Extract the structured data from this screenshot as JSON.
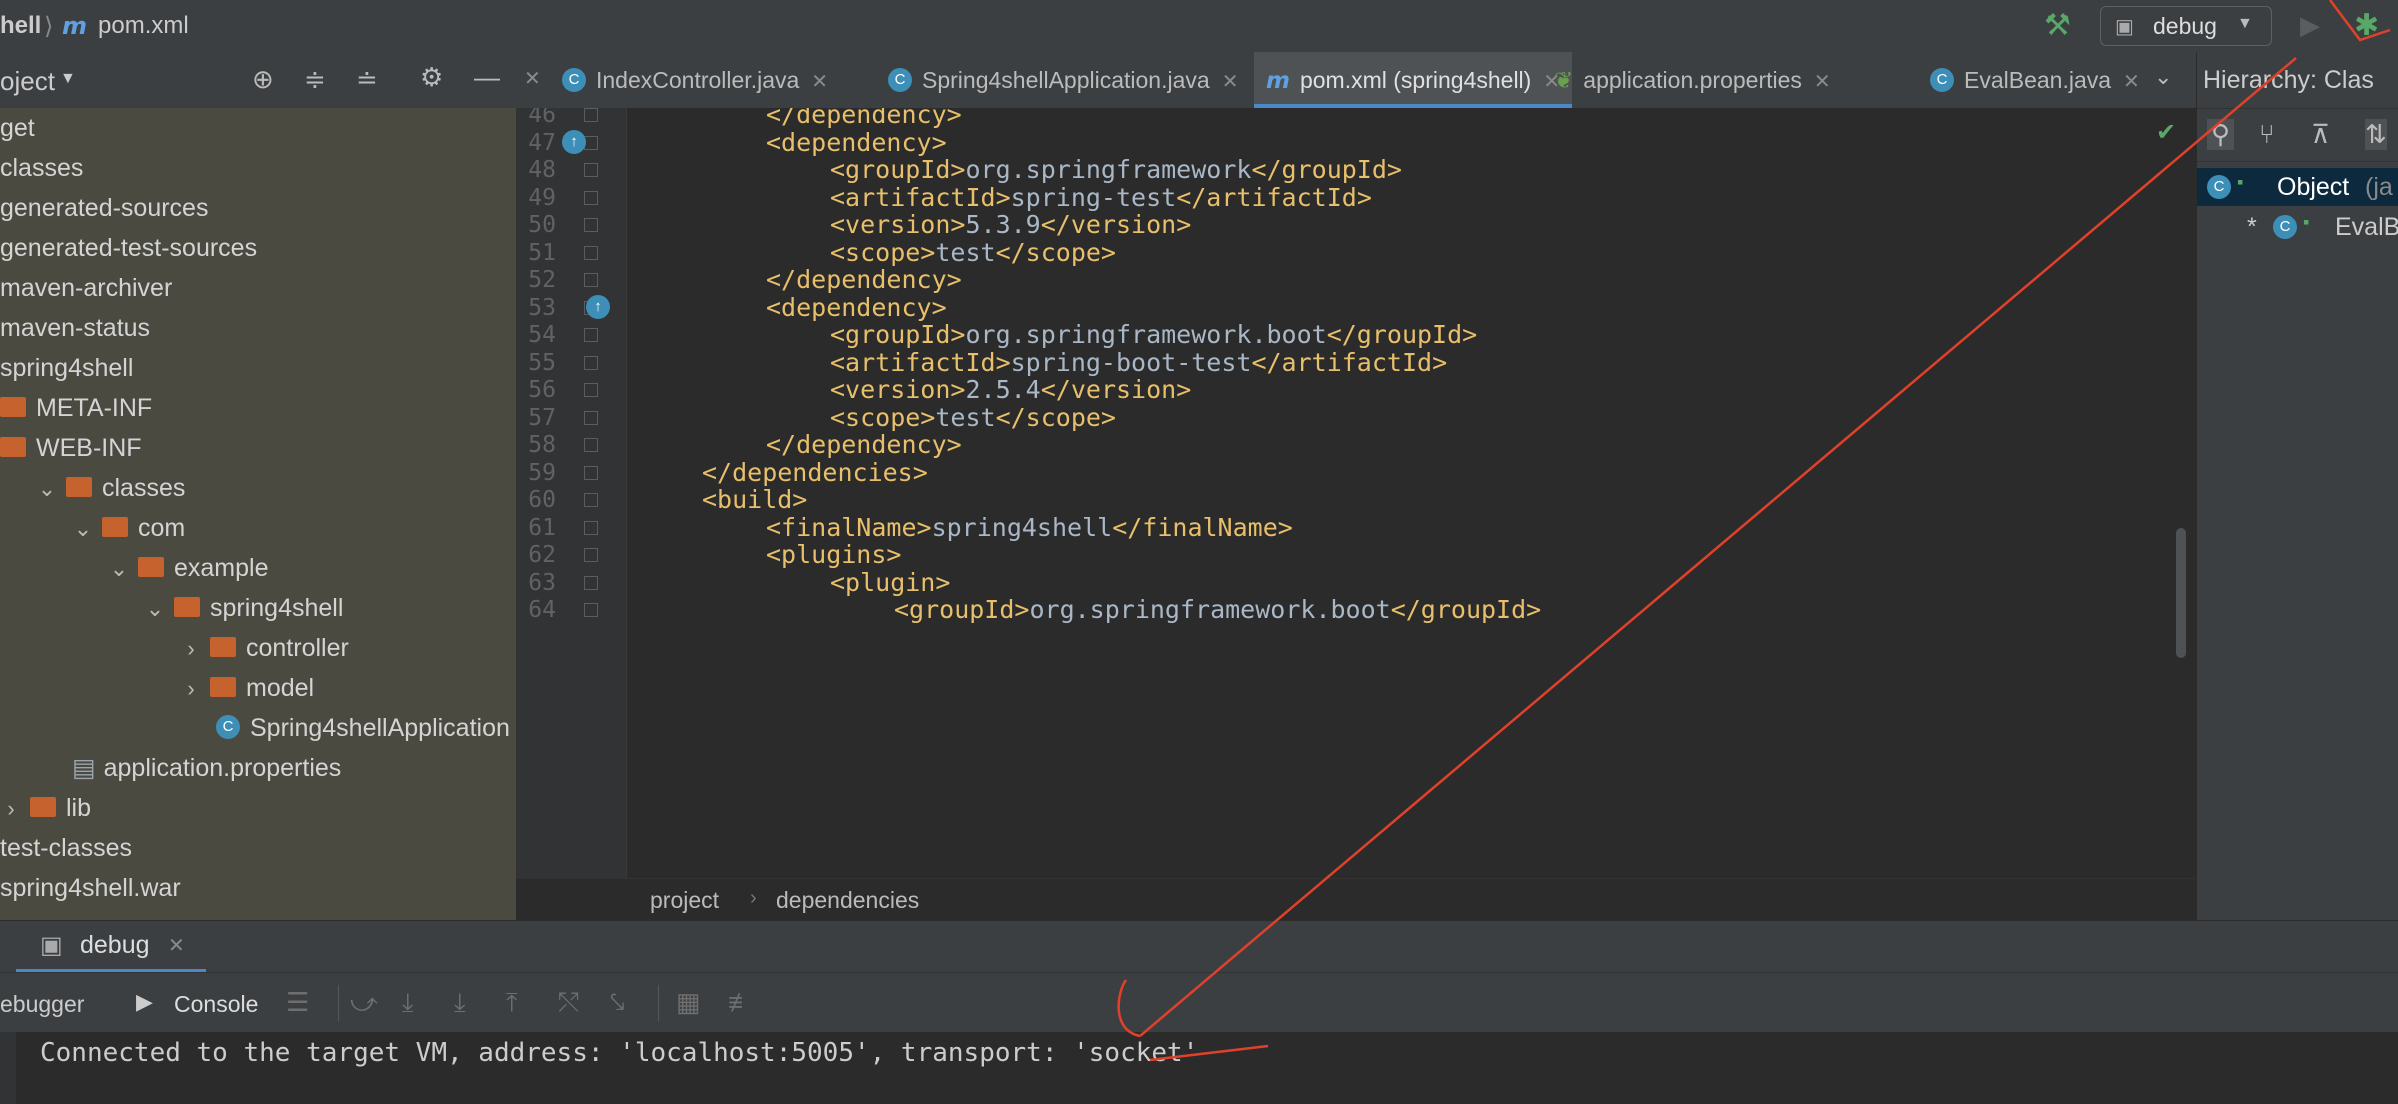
{
  "titlebar": {
    "project_crumb": "hell",
    "file_crumb": "pom.xml",
    "run_config": "debug",
    "colors": {
      "build": "#59a869",
      "debug": "#59a869"
    }
  },
  "project_panel": {
    "title": "oject",
    "tree": [
      {
        "label": "get",
        "type": "text",
        "indent": 0
      },
      {
        "label": "classes",
        "type": "text",
        "indent": 0
      },
      {
        "label": "generated-sources",
        "type": "text",
        "indent": 0
      },
      {
        "label": "generated-test-sources",
        "type": "text",
        "indent": 0
      },
      {
        "label": "maven-archiver",
        "type": "text",
        "indent": 0
      },
      {
        "label": "maven-status",
        "type": "text",
        "indent": 0
      },
      {
        "label": "spring4shell",
        "type": "text",
        "indent": 0
      },
      {
        "label": "META-INF",
        "type": "folder",
        "indent": 0
      },
      {
        "label": "WEB-INF",
        "type": "folder",
        "indent": 0
      },
      {
        "label": "classes",
        "type": "folder-open",
        "indent": 1
      },
      {
        "label": "com",
        "type": "folder-open",
        "indent": 2
      },
      {
        "label": "example",
        "type": "folder-open",
        "indent": 3
      },
      {
        "label": "spring4shell",
        "type": "folder-open",
        "indent": 4
      },
      {
        "label": "controller",
        "type": "folder-closed",
        "indent": 5
      },
      {
        "label": "model",
        "type": "folder-closed",
        "indent": 5
      },
      {
        "label": "Spring4shellApplication",
        "type": "class",
        "indent": 6
      },
      {
        "label": "application.properties",
        "type": "props",
        "indent": 2
      },
      {
        "label": "lib",
        "type": "folder-closed",
        "indent": 0
      },
      {
        "label": "test-classes",
        "type": "text",
        "indent": 0
      },
      {
        "label": "spring4shell.war",
        "type": "text",
        "indent": 0
      }
    ]
  },
  "tabs": [
    {
      "label": "IndexController.java",
      "icon": "class-icon",
      "active": false
    },
    {
      "label": "Spring4shellApplication.java",
      "icon": "spring-class-icon",
      "active": false
    },
    {
      "label": "pom.xml (spring4shell)",
      "icon": "maven-icon",
      "active": true
    },
    {
      "label": "application.properties",
      "icon": "spring-props-icon",
      "active": false
    },
    {
      "label": "EvalBean.java",
      "icon": "class-icon",
      "active": false
    }
  ],
  "editor": {
    "lines": [
      {
        "n": "46",
        "indent": 2,
        "parts": [
          [
            "t",
            "</dependency>"
          ]
        ]
      },
      {
        "n": "47",
        "indent": 2,
        "parts": [
          [
            "t",
            "<dependency>"
          ]
        ]
      },
      {
        "n": "48",
        "indent": 3,
        "parts": [
          [
            "t",
            "<groupId>"
          ],
          [
            "v",
            "org.springframework"
          ],
          [
            "t",
            "</groupId>"
          ]
        ]
      },
      {
        "n": "49",
        "indent": 3,
        "parts": [
          [
            "t",
            "<artifactId>"
          ],
          [
            "v",
            "spring-test"
          ],
          [
            "t",
            "</artifactId>"
          ]
        ]
      },
      {
        "n": "50",
        "indent": 3,
        "parts": [
          [
            "t",
            "<version>"
          ],
          [
            "v",
            "5.3.9"
          ],
          [
            "t",
            "</version>"
          ]
        ]
      },
      {
        "n": "51",
        "indent": 3,
        "parts": [
          [
            "t",
            "<scope>"
          ],
          [
            "v",
            "test"
          ],
          [
            "t",
            "</scope>"
          ]
        ]
      },
      {
        "n": "52",
        "indent": 2,
        "parts": [
          [
            "t",
            "</dependency>"
          ]
        ]
      },
      {
        "n": "53",
        "indent": 2,
        "parts": [
          [
            "t",
            "<dependency>"
          ]
        ]
      },
      {
        "n": "54",
        "indent": 3,
        "parts": [
          [
            "t",
            "<groupId>"
          ],
          [
            "v",
            "org.springframework.boot"
          ],
          [
            "t",
            "</groupId>"
          ]
        ]
      },
      {
        "n": "55",
        "indent": 3,
        "parts": [
          [
            "t",
            "<artifactId>"
          ],
          [
            "v",
            "spring-boot-test"
          ],
          [
            "t",
            "</artifactId>"
          ]
        ]
      },
      {
        "n": "56",
        "indent": 3,
        "parts": [
          [
            "t",
            "<version>"
          ],
          [
            "v",
            "2.5.4"
          ],
          [
            "t",
            "</version>"
          ]
        ]
      },
      {
        "n": "57",
        "indent": 3,
        "parts": [
          [
            "t",
            "<scope>"
          ],
          [
            "v",
            "test"
          ],
          [
            "t",
            "</scope>"
          ]
        ]
      },
      {
        "n": "58",
        "indent": 2,
        "parts": [
          [
            "t",
            "</dependency>"
          ]
        ]
      },
      {
        "n": "59",
        "indent": 1,
        "parts": [
          [
            "t",
            "</dependencies>"
          ]
        ]
      },
      {
        "n": "60",
        "indent": 1,
        "parts": [
          [
            "t",
            "<build>"
          ]
        ]
      },
      {
        "n": "61",
        "indent": 2,
        "parts": [
          [
            "t",
            "<finalName>"
          ],
          [
            "v",
            "spring4shell"
          ],
          [
            "t",
            "</finalName>"
          ]
        ]
      },
      {
        "n": "62",
        "indent": 2,
        "parts": [
          [
            "t",
            "<plugins>"
          ]
        ]
      },
      {
        "n": "63",
        "indent": 3,
        "parts": [
          [
            "t",
            "<plugin>"
          ]
        ]
      },
      {
        "n": "64",
        "indent": 4,
        "parts": [
          [
            "t",
            "<groupId>"
          ],
          [
            "v",
            "org.springframework.boot"
          ],
          [
            "t",
            "</groupId>"
          ]
        ]
      }
    ],
    "breadcrumbs": [
      "project",
      "dependencies"
    ]
  },
  "hierarchy": {
    "title": "Hierarchy:  Clas",
    "items": [
      {
        "label": "Object",
        "suffix": "(ja"
      },
      {
        "label": "EvalB",
        "prefix": "*"
      }
    ]
  },
  "debug": {
    "tab_label": "debug",
    "subtabs": [
      "ebugger",
      "Console"
    ],
    "console_text": "Connected to the target VM, address: 'localhost:5005', transport: 'socket'"
  }
}
